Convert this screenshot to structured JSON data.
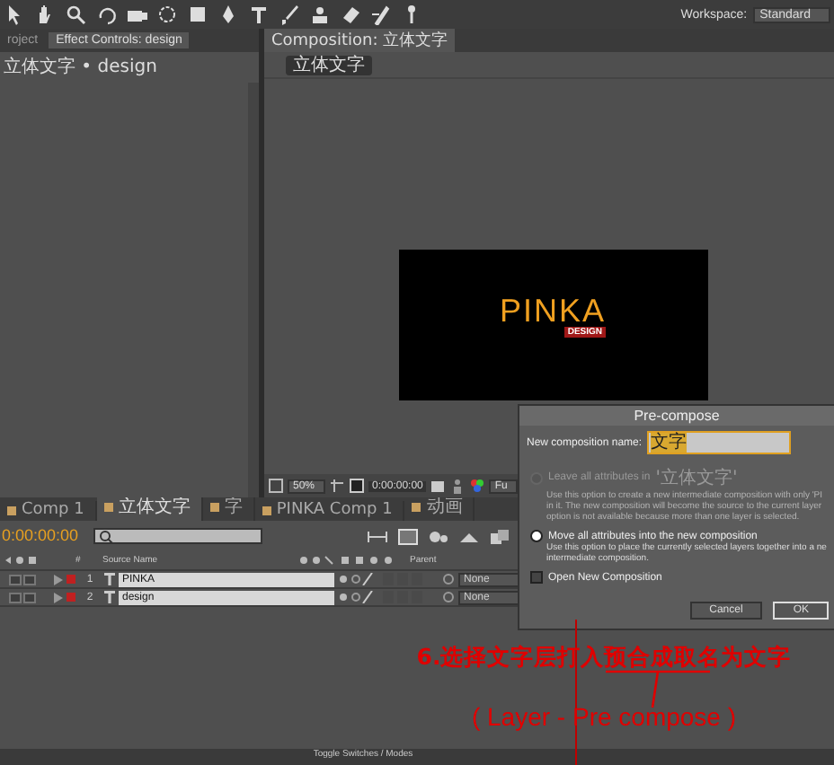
{
  "toolbar": {
    "workspace_label": "Workspace:",
    "workspace_value": "Standard"
  },
  "effect_panel": {
    "tabs": [
      {
        "label": "roject",
        "selected": false
      },
      {
        "label": "Effect Controls: design",
        "selected": true
      }
    ],
    "breadcrumb": "立体文字 • design"
  },
  "composition_panel": {
    "tab": "Composition: 立体文字",
    "comp_button": "立体文字",
    "viewer": {
      "title": "PINKA",
      "subtitle": "DESIGN"
    },
    "zoom": "50%",
    "timecode": "0:00:00:00",
    "resolution": "Fu"
  },
  "timeline": {
    "tabs": [
      {
        "label": "Comp 1",
        "selected": false
      },
      {
        "label": "立体文字",
        "selected": true
      },
      {
        "label": "字",
        "selected": false
      },
      {
        "label": "PINKA Comp 1",
        "selected": false
      },
      {
        "label": "动画",
        "selected": false
      }
    ],
    "timecode": "0:00:00:00",
    "columns": [
      "#",
      "Source Name",
      "Parent"
    ],
    "layers": [
      {
        "number": "1",
        "name": "PINKA",
        "parent": "None",
        "selected": true
      },
      {
        "number": "2",
        "name": "design",
        "parent": "None",
        "selected": true
      }
    ],
    "footer": "Toggle Switches / Modes"
  },
  "dialog": {
    "title": "Pre-compose",
    "name_label": "New composition name:",
    "name_value": "文字",
    "options": [
      {
        "kind": "radio",
        "label": "Leave all attributes in",
        "comp": "'立体文字'",
        "selected": false,
        "disabled": true,
        "description": "Use this option to create a new intermediate composition with only 'PI in it. The new composition will become the source to the current layer option is not available because more than one layer is selected."
      },
      {
        "kind": "radio",
        "label": "Move all attributes into the new composition",
        "selected": true,
        "disabled": false,
        "description": "Use this option to place the currently selected layers together into a ne intermediate composition."
      },
      {
        "kind": "checkbox",
        "label": "Open New Composition",
        "checked": false,
        "disabled": false
      }
    ],
    "buttons": [
      {
        "label": "Cancel",
        "default": false
      },
      {
        "label": "OK",
        "default": true
      }
    ]
  },
  "annotation": {
    "step": "6.选择文字层打入预合成取名为文字",
    "shortcut": "( Layer - Pre compose )"
  }
}
